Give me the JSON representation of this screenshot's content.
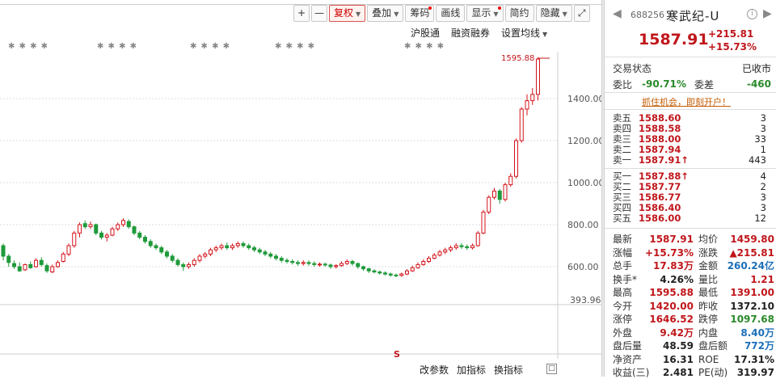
{
  "toolbar": {
    "zoom_in": "+",
    "zoom_out": "—",
    "restore": "复权",
    "overlay": "叠加",
    "chips": "筹码",
    "draw": "画线",
    "display": "显示",
    "simple": "简约",
    "hide": "隐藏",
    "expand_icon": "fullscreen-icon"
  },
  "subbar": {
    "hk_connect": "沪股通",
    "margin": "融资融券",
    "ma_setting": "设置均线"
  },
  "chart": {
    "marks_row": "✱ ✱ ✱ ✱",
    "max_label": "1595.88",
    "last_price_label": "393.96",
    "axis_labels": [
      "1400.00",
      "1200.00",
      "1000.00",
      "800.00",
      "600.00"
    ],
    "s_marker": "S"
  },
  "chart_data": {
    "type": "candlestick",
    "ylim": [
      393.96,
      1650
    ],
    "y_ticks": [
      600,
      800,
      1000,
      1200,
      1400
    ],
    "candles": [
      [
        700,
        650,
        710,
        630
      ],
      [
        650,
        620,
        660,
        600
      ],
      [
        615,
        600,
        630,
        590
      ],
      [
        600,
        580,
        620,
        575
      ],
      [
        585,
        610,
        615,
        580
      ],
      [
        610,
        595,
        625,
        590
      ],
      [
        600,
        630,
        640,
        595
      ],
      [
        630,
        610,
        645,
        600
      ],
      [
        605,
        580,
        615,
        570
      ],
      [
        575,
        600,
        610,
        570
      ],
      [
        600,
        620,
        630,
        595
      ],
      [
        625,
        660,
        670,
        620
      ],
      [
        660,
        700,
        710,
        650
      ],
      [
        700,
        760,
        770,
        690
      ],
      [
        760,
        800,
        810,
        740
      ],
      [
        805,
        790,
        820,
        780
      ],
      [
        790,
        800,
        815,
        780
      ],
      [
        800,
        760,
        805,
        750
      ],
      [
        760,
        740,
        770,
        730
      ],
      [
        740,
        750,
        760,
        720
      ],
      [
        750,
        780,
        790,
        745
      ],
      [
        780,
        800,
        810,
        770
      ],
      [
        800,
        820,
        830,
        790
      ],
      [
        815,
        790,
        825,
        780
      ],
      [
        790,
        760,
        795,
        750
      ],
      [
        760,
        740,
        770,
        730
      ],
      [
        740,
        720,
        750,
        710
      ],
      [
        720,
        700,
        730,
        690
      ],
      [
        700,
        690,
        710,
        680
      ],
      [
        690,
        670,
        700,
        660
      ],
      [
        670,
        650,
        680,
        640
      ],
      [
        650,
        630,
        660,
        620
      ],
      [
        630,
        610,
        640,
        600
      ],
      [
        610,
        600,
        620,
        580
      ],
      [
        600,
        610,
        620,
        590
      ],
      [
        610,
        630,
        640,
        600
      ],
      [
        630,
        650,
        660,
        620
      ],
      [
        650,
        660,
        670,
        640
      ],
      [
        660,
        680,
        690,
        650
      ],
      [
        680,
        690,
        700,
        670
      ],
      [
        690,
        700,
        710,
        680
      ],
      [
        700,
        690,
        715,
        680
      ],
      [
        690,
        700,
        710,
        680
      ],
      [
        700,
        710,
        720,
        690
      ],
      [
        710,
        700,
        720,
        690
      ],
      [
        700,
        690,
        710,
        680
      ],
      [
        690,
        680,
        700,
        670
      ],
      [
        680,
        670,
        690,
        660
      ],
      [
        670,
        660,
        680,
        650
      ],
      [
        660,
        650,
        670,
        640
      ],
      [
        650,
        640,
        660,
        630
      ],
      [
        640,
        630,
        650,
        620
      ],
      [
        630,
        625,
        640,
        615
      ],
      [
        625,
        620,
        635,
        610
      ],
      [
        620,
        615,
        630,
        605
      ],
      [
        615,
        620,
        630,
        605
      ],
      [
        620,
        615,
        630,
        605
      ],
      [
        615,
        610,
        625,
        600
      ],
      [
        610,
        612,
        620,
        600
      ],
      [
        612,
        608,
        620,
        600
      ],
      [
        608,
        600,
        615,
        590
      ],
      [
        600,
        605,
        612,
        592
      ],
      [
        605,
        615,
        625,
        600
      ],
      [
        615,
        625,
        635,
        608
      ],
      [
        625,
        615,
        632,
        605
      ],
      [
        615,
        600,
        620,
        590
      ],
      [
        600,
        590,
        605,
        580
      ],
      [
        590,
        580,
        595,
        570
      ],
      [
        580,
        575,
        588,
        568
      ],
      [
        575,
        570,
        582,
        562
      ],
      [
        570,
        565,
        578,
        558
      ],
      [
        565,
        560,
        572,
        552
      ],
      [
        560,
        558,
        568,
        550
      ],
      [
        558,
        565,
        572,
        552
      ],
      [
        565,
        580,
        588,
        560
      ],
      [
        580,
        595,
        605,
        575
      ],
      [
        595,
        610,
        620,
        590
      ],
      [
        610,
        625,
        635,
        605
      ],
      [
        625,
        640,
        650,
        618
      ],
      [
        640,
        655,
        665,
        635
      ],
      [
        655,
        670,
        680,
        648
      ],
      [
        670,
        680,
        690,
        660
      ],
      [
        680,
        690,
        700,
        670
      ],
      [
        690,
        700,
        712,
        680
      ],
      [
        700,
        695,
        712,
        685
      ],
      [
        695,
        690,
        705,
        680
      ],
      [
        690,
        700,
        710,
        682
      ],
      [
        700,
        760,
        770,
        695
      ],
      [
        760,
        860,
        870,
        755
      ],
      [
        860,
        930,
        940,
        850
      ],
      [
        930,
        960,
        975,
        920
      ],
      [
        960,
        920,
        970,
        900
      ],
      [
        920,
        990,
        1000,
        910
      ],
      [
        990,
        1030,
        1045,
        980
      ],
      [
        1030,
        1200,
        1210,
        1020
      ],
      [
        1200,
        1350,
        1360,
        1190
      ],
      [
        1350,
        1390,
        1420,
        1320
      ],
      [
        1390,
        1420,
        1450,
        1370
      ],
      [
        1420,
        1588,
        1596,
        1391
      ]
    ]
  },
  "bottom": {
    "edit_params": "改参数",
    "add_indicator": "加指标",
    "switch_indicator": "换指标",
    "box_icon": "expand-box-icon"
  },
  "side": {
    "code": "688256",
    "name": "寒武纪-U",
    "price": "1587.91",
    "change": "+215.81",
    "change_pct": "+15.73%",
    "status_label": "交易状态",
    "status_value": "已收市",
    "ratio_label": "委比",
    "ratio_value": "-90.71%",
    "diff_label": "委差",
    "diff_value": "-460",
    "banner": "抓住机会，即刻开户！",
    "asks": [
      {
        "name": "卖五",
        "price": "1588.60",
        "vol": "3"
      },
      {
        "name": "卖四",
        "price": "1588.58",
        "vol": "3"
      },
      {
        "name": "卖三",
        "price": "1588.00",
        "vol": "33"
      },
      {
        "name": "卖二",
        "price": "1587.94",
        "vol": "1"
      },
      {
        "name": "卖一",
        "price": "1587.91↑",
        "vol": "443"
      }
    ],
    "bids": [
      {
        "name": "买一",
        "price": "1587.88↑",
        "vol": "4"
      },
      {
        "name": "买二",
        "price": "1587.77",
        "vol": "2"
      },
      {
        "name": "买三",
        "price": "1586.77",
        "vol": "3"
      },
      {
        "name": "买四",
        "price": "1586.40",
        "vol": "3"
      },
      {
        "name": "买五",
        "price": "1586.00",
        "vol": "12"
      }
    ],
    "quotes": [
      {
        "a": "最新",
        "b": "1587.91",
        "bc": "red",
        "c": "均价",
        "d": "1459.80",
        "dc": "red"
      },
      {
        "a": "涨幅",
        "b": "+15.73%",
        "bc": "red",
        "c": "涨跌",
        "d": "▲215.81",
        "dc": "red"
      },
      {
        "a": "总手",
        "b": "17.83万",
        "bc": "red",
        "c": "金额",
        "d": "260.24亿",
        "dc": "blue"
      },
      {
        "a": "换手*",
        "b": "4.26%",
        "bc": "",
        "c": "量比",
        "d": "1.21",
        "dc": "red"
      },
      {
        "a": "最高",
        "b": "1595.88",
        "bc": "red",
        "c": "最低",
        "d": "1391.00",
        "dc": "red"
      },
      {
        "a": "今开",
        "b": "1420.00",
        "bc": "red",
        "c": "昨收",
        "d": "1372.10",
        "dc": ""
      },
      {
        "a": "涨停",
        "b": "1646.52",
        "bc": "red",
        "c": "跌停",
        "d": "1097.68",
        "dc": "green"
      },
      {
        "a": "外盘",
        "b": "9.42万",
        "bc": "red",
        "c": "内盘",
        "d": "8.40万",
        "dc": "blue"
      },
      {
        "a": "盘后量",
        "b": "48.59",
        "bc": "",
        "c": "盘后额",
        "d": "772万",
        "dc": "blue"
      },
      {
        "a": "净资产",
        "b": "16.31",
        "bc": "",
        "c": "ROE",
        "d": "17.31%",
        "dc": ""
      },
      {
        "a": "收益(三)",
        "b": "2.481",
        "bc": "",
        "c": "PE(动)",
        "d": "319.97",
        "dc": ""
      }
    ]
  }
}
